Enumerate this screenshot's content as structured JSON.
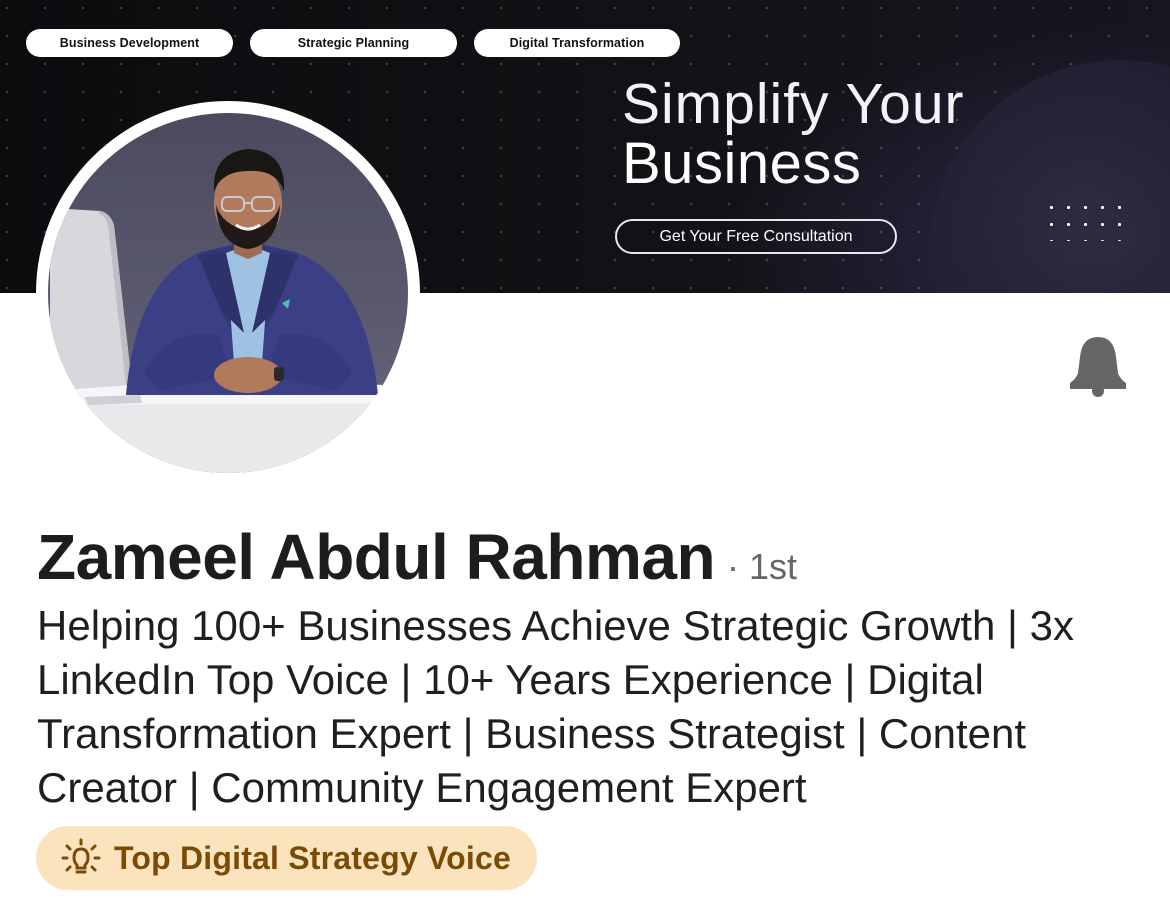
{
  "banner": {
    "tags": [
      "Business Development",
      "Strategic Planning",
      "Digital Transformation"
    ],
    "headline_line1": "Simplify Your",
    "headline_line2": "Business",
    "cta_label": "Get Your Free Consultation"
  },
  "profile": {
    "name": "Zameel Abdul Rahman",
    "connection_degree": "· 1st",
    "headline": "Helping 100+ Businesses Achieve Strategic Growth | 3x LinkedIn Top Voice | 10+ Years Experience | Digital Transformation Expert | Business Strategist | Content Creator | Community Engagement Expert",
    "top_voice_badge": "Top Digital Strategy Voice"
  },
  "icons": {
    "notification": "bell-icon",
    "badge": "lightbulb-icon"
  },
  "colors": {
    "badge_background": "#fbe3bd",
    "badge_text": "#7a4b07",
    "bell": "#666666",
    "name": "#1d1d1d"
  }
}
